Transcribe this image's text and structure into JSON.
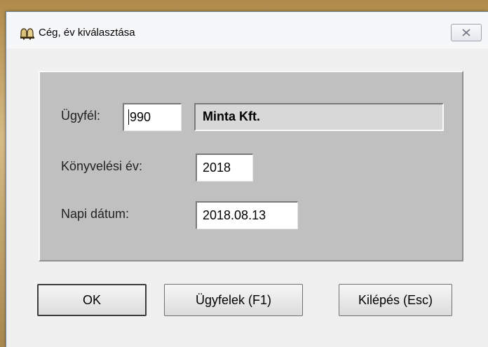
{
  "window": {
    "title": "Cég, év kiválasztása"
  },
  "icons": {
    "app_icon": "bell-pair-icon",
    "close_icon": "close-x-icon"
  },
  "form": {
    "client_label": "Ügyfél:",
    "client_code": "990",
    "client_name": "Minta Kft.",
    "year_label": "Könyvelési év:",
    "year_value": "2018",
    "date_label": "Napi dátum:",
    "date_value": "2018.08.13"
  },
  "buttons": {
    "ok": "OK",
    "clients": "Ügyfelek (F1)",
    "exit": "Kilépés (Esc)"
  }
}
